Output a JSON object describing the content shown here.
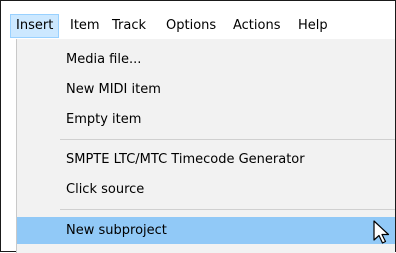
{
  "menubar": {
    "items": [
      {
        "label": "Insert",
        "active": true
      },
      {
        "label": "Item"
      },
      {
        "label": "Track"
      },
      {
        "label": "Options"
      },
      {
        "label": "Actions"
      },
      {
        "label": "Help"
      }
    ]
  },
  "dropdown": {
    "items": [
      {
        "label": "Media file..."
      },
      {
        "label": "New MIDI item"
      },
      {
        "label": "Empty item"
      },
      {
        "label": "SMPTE LTC/MTC Timecode Generator"
      },
      {
        "label": "Click source"
      },
      {
        "label": "New subproject",
        "highlighted": true
      }
    ]
  },
  "colors": {
    "menubar_active_bg": "#cce8ff",
    "menu_highlight_bg": "#91c9f7",
    "menu_bg": "#f2f2f2"
  },
  "icons": {
    "cursor": "mouse-pointer-icon"
  }
}
